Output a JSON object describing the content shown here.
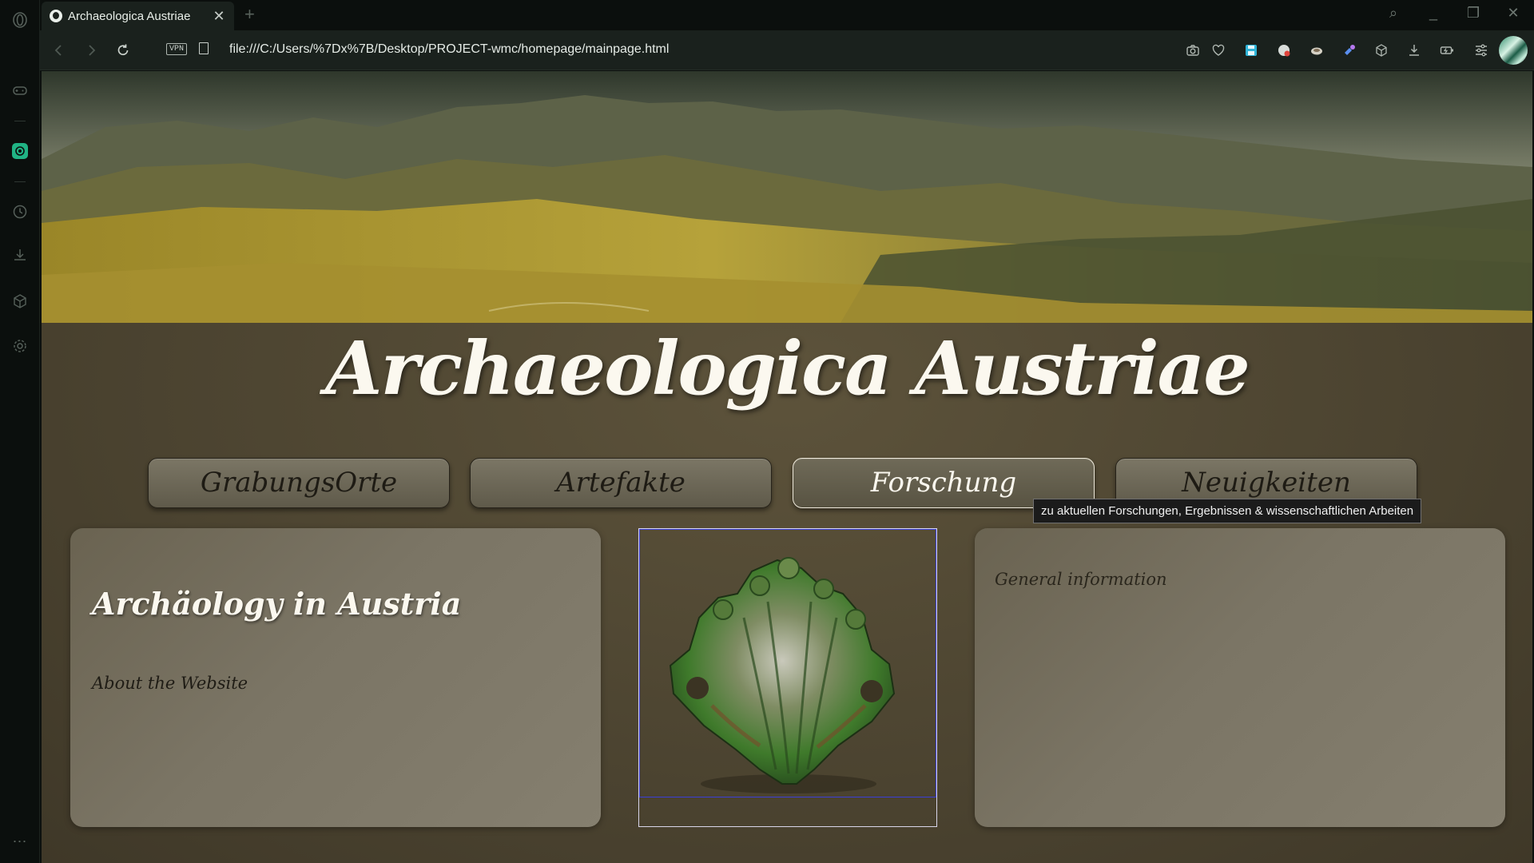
{
  "browser": {
    "tab_title": "Archaeologica Austriae",
    "tab_close": "✕",
    "new_tab": "+",
    "vpn_label": "VPN",
    "url": "file:///C:/Users/%7Dx%7B/Desktop/PROJECT-wmc/homepage/mainpage.html",
    "window_controls": {
      "search": "⌕",
      "minimize": "_",
      "restore": "❐",
      "close": "✕"
    }
  },
  "page": {
    "site_title": "Archaeologica Austriae",
    "nav": [
      {
        "label": "GrabungsOrte"
      },
      {
        "label": "Artefakte"
      },
      {
        "label": "Forschung",
        "active": true
      },
      {
        "label": "Neuigkeiten"
      }
    ],
    "tooltip": "zu aktuellen Forschungen, Ergebnissen & wissenschaftlichen Arbeiten",
    "left_panel": {
      "heading": "Archäology in Austria",
      "text": "About the Website"
    },
    "right_panel": {
      "text": "General information"
    }
  },
  "colors": {
    "accent_active_border": "#efeadb",
    "page_bg": "#4b4330",
    "focus_outline": "#3b3fd6"
  }
}
